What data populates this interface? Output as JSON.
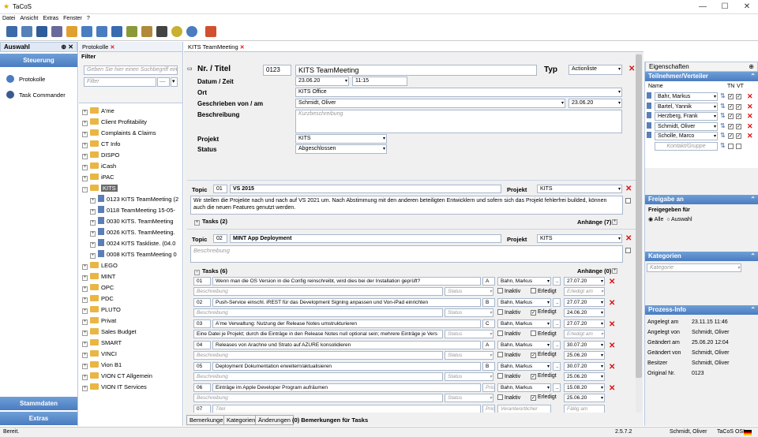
{
  "window": {
    "title": "TaCoS",
    "min": "—",
    "max": "☐",
    "close": "✕"
  },
  "menu": [
    "Datei",
    "Ansicht",
    "Extras",
    "Fenster",
    "?"
  ],
  "left": {
    "header": "Auswahl",
    "steuerung": "Steuerung",
    "items": [
      "Protokolle",
      "Task Commander"
    ],
    "stammdaten": "Stammdaten",
    "extras": "Extras"
  },
  "protokolle_tab": "Protokolle",
  "filter": {
    "label": "Filter",
    "search_placeholder": "Geben Sie hier einen Suchbegriff ein",
    "filter_placeholder": "Filter",
    "dots": "...."
  },
  "tree": {
    "top": [
      "A'me",
      "Client Profitability",
      "Complaints & Claims",
      "CT Info",
      "DISPO",
      "iCash",
      "iPAC"
    ],
    "selected": "KITS",
    "children": [
      "0123 KITS TeamMeeting (2",
      "0118 TeamMeeting 15-05-",
      "0030 KITS. TeamMeeting",
      "0026 KITS. TeamMeeting.",
      "0024 KITS Taskliste. (04.0",
      "0008 KITS TeamMeeting 0"
    ],
    "bottom": [
      "LEGO",
      "MINT",
      "OPC",
      "PDC",
      "PLUTO",
      "Privat",
      "Sales Budget",
      "SMART",
      "VINCI",
      "Vion B1",
      "VION CT Allgemein",
      "VION IT Services"
    ]
  },
  "doc_tab": "KITS TeamMeeting",
  "form": {
    "nr_label": "Nr. / Titel",
    "nr": "0123",
    "titel": "KITS TeamMeeting",
    "typ_label": "Typ",
    "typ": "Actionliste",
    "datum_label": "Datum / Zeit",
    "datum": "23.06.20",
    "zeit": "11:15",
    "ort_label": "Ort",
    "ort": "KITS Office",
    "geschrieben_label": "Geschrieben von / am",
    "geschrieben": "Schmidt, Oliver",
    "geschrieben_am": "23.06.20",
    "beschreibung_label": "Beschreibung",
    "beschreibung_ph": "Kurzbeschreibung",
    "projekt_label": "Projekt",
    "projekt": "KITS",
    "status_label": "Status",
    "status": "Abgeschlossen"
  },
  "topic1": {
    "label": "Topic",
    "nr": "01",
    "title": "VS 2015",
    "projekt_label": "Projekt",
    "projekt": "KITS",
    "text": "Wir stellen die Projekte nach und nach auf VS 2021 um. Nach Abstimmung mit den anderen beteiligten Entwicklern und sofern sich das Projekt fehlerfrei builded, können auch die neuen Features genutzt werden.",
    "tasks": "Tasks (2)",
    "anhaenge": "Anhänge (7)"
  },
  "topic2": {
    "label": "Topic",
    "nr": "02",
    "title": "MINT App Deployment",
    "projekt_label": "Projekt",
    "projekt": "KITS",
    "beschreibung_ph": "Beschreibung",
    "tasks": "Tasks (6)",
    "anhaenge": "Anhänge (0)"
  },
  "tasks": [
    {
      "nr": "01",
      "text": "Wenn man die OS Version in die Config reinschreibt, wird dies bei der Installation geprüft?",
      "prio": "A",
      "person": "Bahn, Markus",
      "date": "27.07.20",
      "erledigt_date": "Erledigt am",
      "erledigt": false
    },
    {
      "nr": "02",
      "text": "Push-Service einschl. iREST für das Development Signing anpassen und Von-iPad einrichten",
      "prio": "B",
      "person": "Bahn, Markus",
      "date": "27.07.20",
      "erledigt_date": "24.06.20",
      "erledigt": true
    },
    {
      "nr": "03",
      "text": "A'me Verwaltung: Nutzung der Release Notes umstrukturieren",
      "prio": "C",
      "person": "Bahn, Markus",
      "date": "27.07.20",
      "erledigt_date": "Erledigt am",
      "erledigt": false,
      "extra": "Eine Datei je Projekt; durch die Einträge in den Release Notes null optional sein; mehrere Einträge je Vers"
    },
    {
      "nr": "04",
      "text": "Releases von Arachne und Strato auf AZURE konsolidieren",
      "prio": "A",
      "person": "Bahn, Markus",
      "date": "30.07.20",
      "erledigt_date": "25.06.20",
      "erledigt": true
    },
    {
      "nr": "05",
      "text": "Deployment Dokumentation erweitern/aktualisieren",
      "prio": "B",
      "person": "Bahn, Markus",
      "date": "30.07.20",
      "erledigt_date": "25.06.20",
      "erledigt": true
    },
    {
      "nr": "06",
      "text": "Einträge im Apple Developer Program aufräumen",
      "prio": "Prio",
      "person": "Bahn, Markus",
      "date": "15.08.20",
      "erledigt_date": "25.06.20",
      "erledigt": true
    }
  ],
  "task_labels": {
    "beschreibung": "Beschreibung",
    "status": "Status",
    "inaktiv": "Inaktiv",
    "erledigt": "Erledigt",
    "nr7": "07",
    "titel_ph": "Titel",
    "prio_ph": "Prio",
    "verantw_ph": "Verantwortlicher",
    "faellig_ph": "Fällig am"
  },
  "bottom_tabs": [
    "Bemerkungen",
    "Kategorien",
    "Änderungen"
  ],
  "bottom_note": "(0) Bemerkungen für Tasks",
  "right": {
    "header": "Eigenschaften",
    "teilnehmer": "Teilnehmer/Verteiler",
    "name_col": "Name",
    "tn": "TN",
    "vt": "VT",
    "people": [
      "Bahr, Markus",
      "Bartel, Yannik",
      "Herzberg, Frank",
      "Schmidt, Oliver",
      "Scholle, Marco"
    ],
    "kontakt_ph": "Kontakt/Gruppe",
    "freigabe": "Freigabe an",
    "freigegeben": "Freigegeben für",
    "alle": "Alle",
    "auswahl": "Auswahl",
    "kategorien": "Kategorien",
    "kategorie_ph": "Kategorie",
    "prozess": "Prozess-Info",
    "info": [
      [
        "Angelegt am",
        "23.11.15 11:46"
      ],
      [
        "Angelegt von",
        "Schmidt, Oliver"
      ],
      [
        "Geändert am",
        "25.06.20 12:04"
      ],
      [
        "Geändert von",
        "Schmidt, Oliver"
      ],
      [
        "Besitzer",
        "Schmidt, Oliver"
      ],
      [
        "Original Nr.",
        "0123"
      ]
    ]
  },
  "status": {
    "left": "Bereit.",
    "version": "2.5.7.2",
    "user": "Schmidt, Oliver",
    "app": "TaCoS OSI"
  },
  "colors": {
    "accent": "#4a7cc0",
    "red": "#dd1111"
  }
}
